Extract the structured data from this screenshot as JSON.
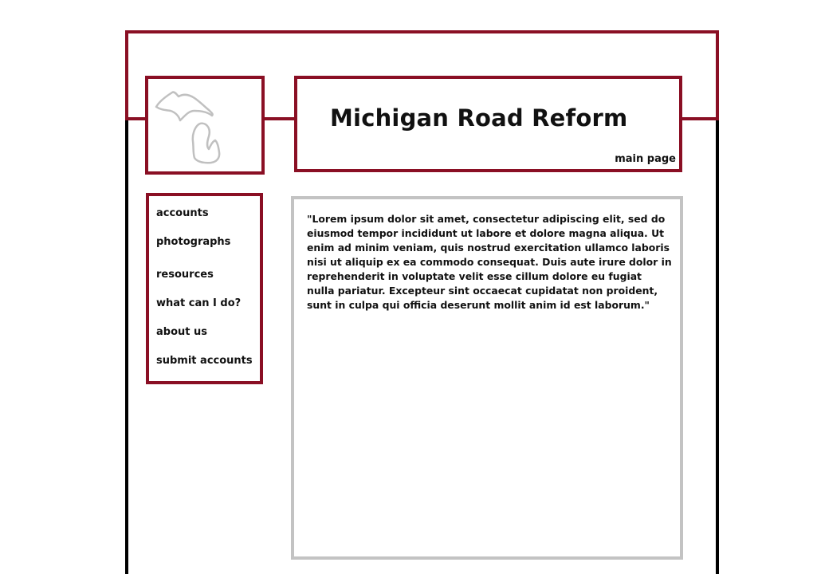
{
  "header": {
    "title": "Michigan Road Reform",
    "main_page_label": "main page"
  },
  "logo": {
    "icon": "michigan-map-icon"
  },
  "nav": {
    "items": [
      {
        "label": "accounts"
      },
      {
        "label": "photographs"
      },
      {
        "label": "resources"
      },
      {
        "label": "what can I do?"
      },
      {
        "label": "about us"
      },
      {
        "label": "submit accounts"
      }
    ]
  },
  "content": {
    "body": "\"Lorem ipsum dolor sit amet, consectetur adipiscing elit, sed do eiusmod tempor incididunt ut labore et dolore magna aliqua. Ut enim ad minim veniam, quis nostrud exercitation ullamco laboris nisi ut aliquip ex ea commodo consequat. Duis aute irure dolor in reprehenderit in voluptate velit esse cillum dolore eu fugiat nulla pariatur. Excepteur sint occaecat cupidatat non proident, sunt in culpa qui officia deserunt mollit anim id est laborum.\""
  },
  "colors": {
    "accent": "#8a0f24",
    "frame_lower": "#000000",
    "content_border": "#c3c3c3",
    "logo_stroke": "#c0c0c0"
  }
}
